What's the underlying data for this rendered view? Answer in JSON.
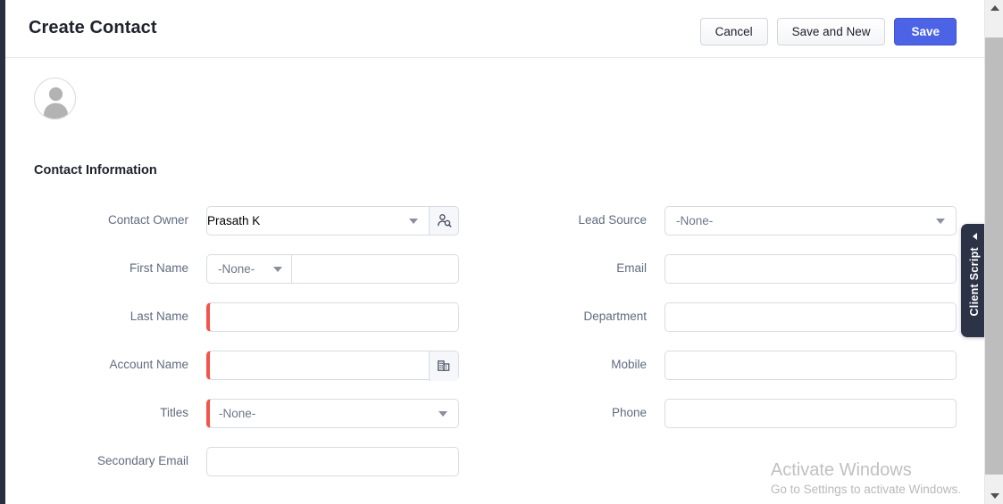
{
  "header": {
    "title": "Create Contact",
    "buttons": [
      {
        "label": "Cancel",
        "kind": "secondary",
        "name": "cancel-button"
      },
      {
        "label": "Save and New",
        "kind": "secondary",
        "name": "save-and-new-button"
      },
      {
        "label": "Save",
        "kind": "primary",
        "name": "save-button"
      }
    ]
  },
  "avatar": {
    "icon": "user-avatar-placeholder-icon"
  },
  "section": {
    "title": "Contact Information"
  },
  "fields": {
    "contact_owner": {
      "label": "Contact Owner",
      "value": "Prasath K",
      "lookup_icon": "user-lookup-icon",
      "required": false
    },
    "first_name": {
      "label": "First Name",
      "salutation": "-None-",
      "value": "",
      "placeholder": "",
      "required": false
    },
    "last_name": {
      "label": "Last Name",
      "value": "",
      "placeholder": "",
      "required": true
    },
    "account_name": {
      "label": "Account Name",
      "value": "",
      "placeholder": "",
      "lookup_icon": "company-lookup-icon",
      "required": true
    },
    "titles": {
      "label": "Titles",
      "value": "-None-",
      "required": true
    },
    "secondary_email": {
      "label": "Secondary Email",
      "value": "",
      "placeholder": "",
      "required": false
    },
    "lead_source": {
      "label": "Lead Source",
      "value": "-None-",
      "required": false
    },
    "email": {
      "label": "Email",
      "value": "",
      "placeholder": "",
      "required": false
    },
    "department": {
      "label": "Department",
      "value": "",
      "placeholder": "",
      "required": false
    },
    "mobile": {
      "label": "Mobile",
      "value": "",
      "placeholder": "",
      "required": false
    },
    "phone": {
      "label": "Phone",
      "value": "",
      "placeholder": "",
      "required": false
    }
  },
  "client_script_tab": {
    "label": "Client Script",
    "arrow_icon": "chevron-left-icon"
  },
  "watermark": {
    "title": "Activate Windows",
    "subtitle": "Go to Settings to activate Windows."
  },
  "scrollbar": {
    "up_icon": "scroll-up-arrow-icon",
    "down_icon": "scroll-down-arrow-icon"
  },
  "colors": {
    "primary": "#4c63e6",
    "required_marker": "#f2544c",
    "label_text": "#5f6b7e",
    "title_text": "#20232e",
    "tab_dark": "#2d3346",
    "border": "#d7dbe3"
  }
}
